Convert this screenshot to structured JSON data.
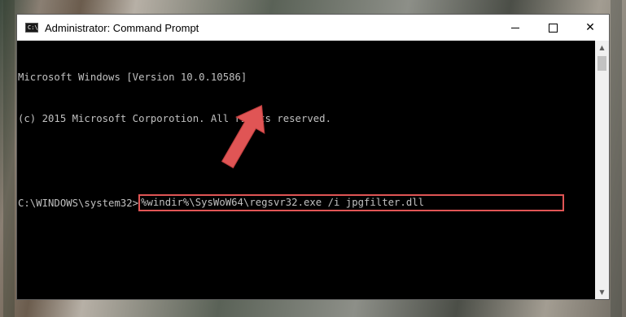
{
  "window": {
    "title": "Administrator: Command Prompt",
    "icon": "cmd-app-icon",
    "icon_text": "C:\\",
    "controls": {
      "minimize": "minimize-icon",
      "maximize": "maximize-icon",
      "close": "close-icon"
    },
    "close_glyph": "✕"
  },
  "console": {
    "lines": [
      "Microsoft Windows [Version 10.0.10586]",
      "(c) 2015 Microsoft Corporotion. All rights reserved.",
      ""
    ],
    "prompt": "C:\\WINDOWS\\system32>",
    "command": "%windir%\\SysWoW64\\regsvr32.exe /i jpgfilter.dll"
  },
  "scrollbar": {
    "up_glyph": "▲",
    "down_glyph": "▼"
  },
  "annotation": {
    "highlight_color": "#e05555",
    "arrow_color": "#e05555"
  }
}
